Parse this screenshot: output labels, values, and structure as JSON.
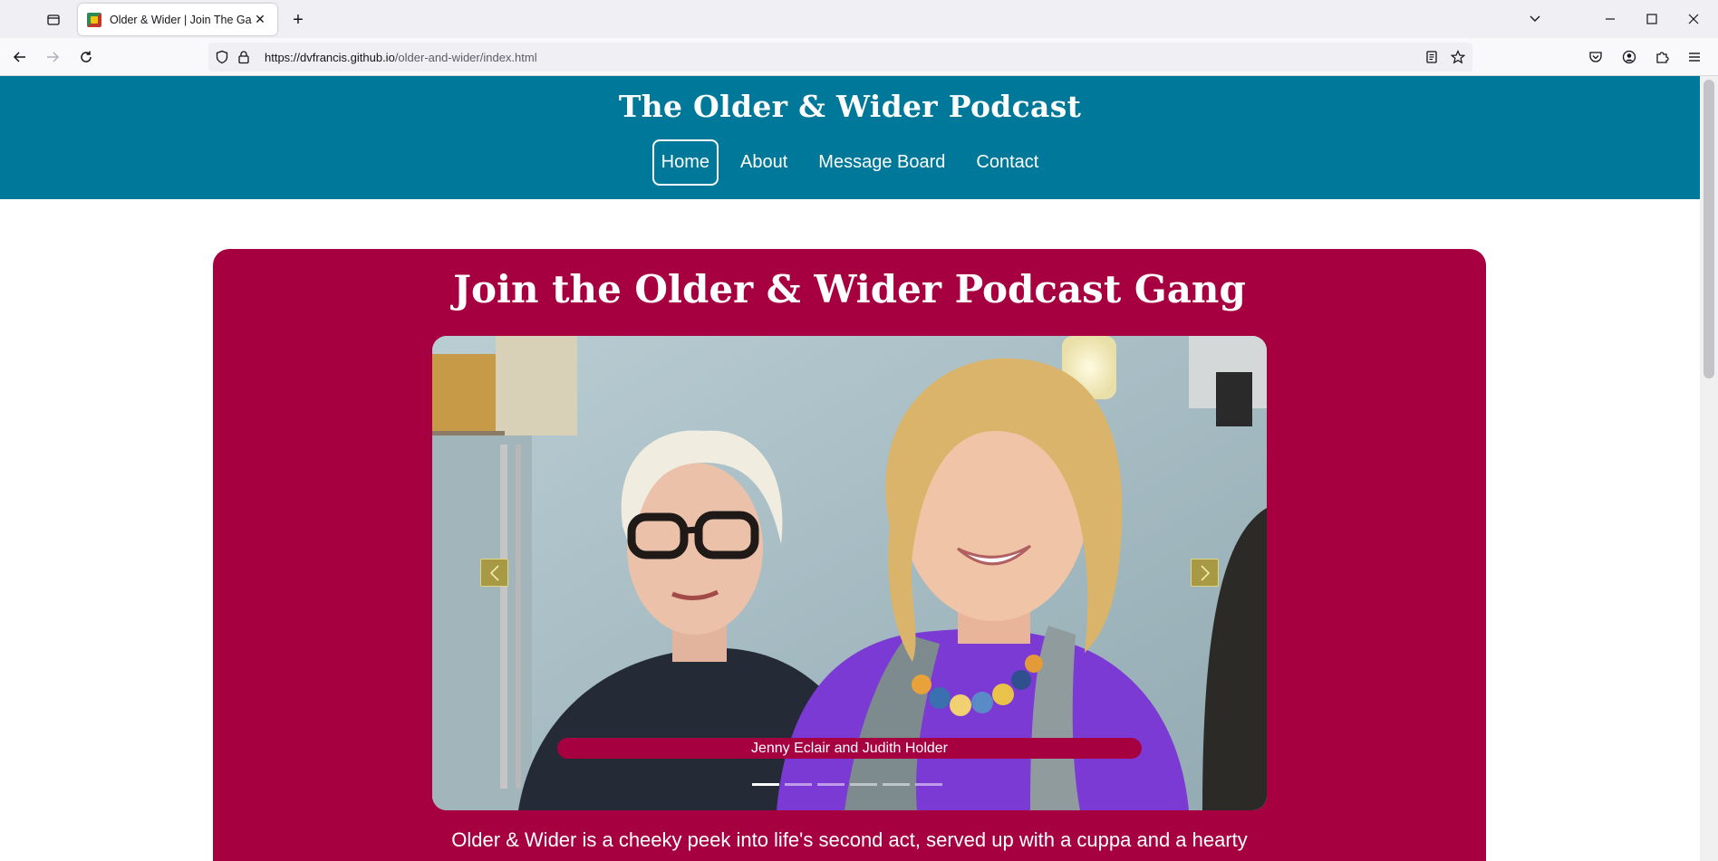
{
  "browser": {
    "tab_title": "Older & Wider | Join The Gang",
    "url_host": "https://dvfrancis.github.io",
    "url_path": "/older-and-wider/index.html"
  },
  "site": {
    "title": "The Older & Wider Podcast",
    "nav": [
      "Home",
      "About",
      "Message Board",
      "Contact"
    ],
    "active_nav": "Home"
  },
  "main": {
    "heading": "Join the Older & Wider Podcast Gang",
    "carousel": {
      "caption": "Jenny Eclair and Judith Holder",
      "slide_count": 6,
      "active_slide": 1
    },
    "intro_text": "Older & Wider is a cheeky peek into life's second act, served up with a cuppa and a hearty"
  },
  "colors": {
    "header": "#007899",
    "card": "#a70041",
    "carousel_control": "#a89a44"
  }
}
